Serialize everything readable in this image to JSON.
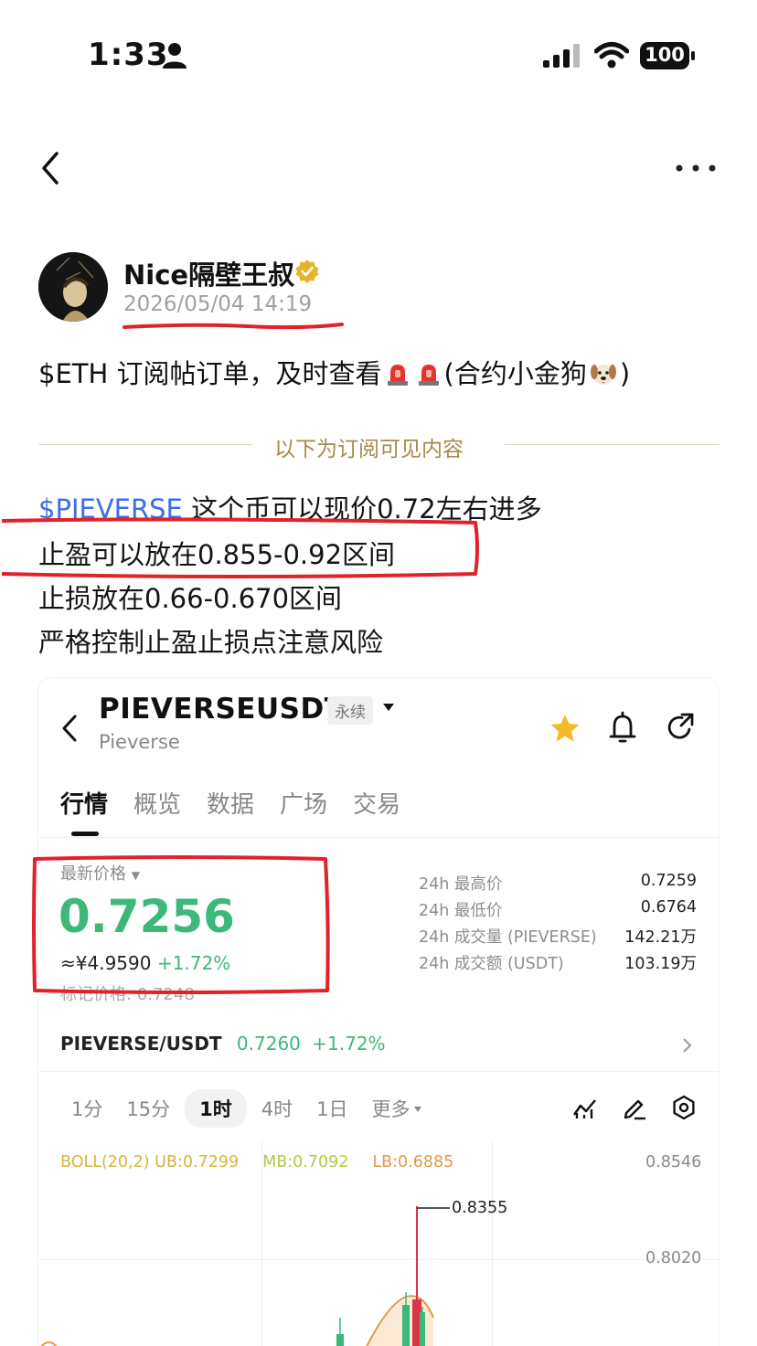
{
  "status_bar": {
    "time": "1:33",
    "battery": "100"
  },
  "author": {
    "name": "Nice隔壁王叔",
    "time": "2026/05/04 14:19"
  },
  "post": {
    "title_prefix": "$ETH 订阅帖订单，及时查看",
    "title_suffix": "(合约小金狗",
    "title_end": ")",
    "divider": "以下为订阅可见内容",
    "ticker": "$PIEVERSE",
    "line1_rest": " 这个币可以现价0.72左右进多",
    "line2": "止盈可以放在0.855-0.92区间",
    "line3": "止损放在0.66-0.670区间",
    "line4": "严格控制止盈止损点注意风险"
  },
  "card": {
    "symbol": "PIEVERSEUSDT",
    "tag": "永续",
    "subtitle": "Pieverse",
    "tabs": [
      "行情",
      "概览",
      "数据",
      "广场",
      "交易"
    ],
    "latest_price_label": "最新价格",
    "latest_price": "0.7256",
    "cny_price": "≈¥4.9590",
    "change": "+1.72%",
    "mark_price": "标记价格: 0.7248",
    "stats": [
      {
        "label": "24h 最高价",
        "value": "0.7259"
      },
      {
        "label": "24h 最低价",
        "value": "0.6764"
      },
      {
        "label": "24h 成交量 (PIEVERSE)",
        "value": "142.21万"
      },
      {
        "label": "24h 成交额 (USDT)",
        "value": "103.19万"
      }
    ],
    "pair": {
      "name": "PIEVERSE/USDT",
      "price": "0.7260",
      "change": "+1.72%"
    },
    "intervals": [
      "1分",
      "15分",
      "1时",
      "4时",
      "1日",
      "更多"
    ],
    "active_interval": "1时",
    "boll": {
      "ub": "BOLL(20,2) UB:0.7299",
      "mb": "MB:0.7092",
      "lb": "LB:0.6885"
    },
    "axis": {
      "top": "0.8546",
      "mid": "0.8020"
    },
    "peak": "0.8355"
  },
  "colors": {
    "up": "#3cb878",
    "link": "#3b6ee8",
    "annotation": "#e0232b",
    "gold": "#a68a4b"
  }
}
